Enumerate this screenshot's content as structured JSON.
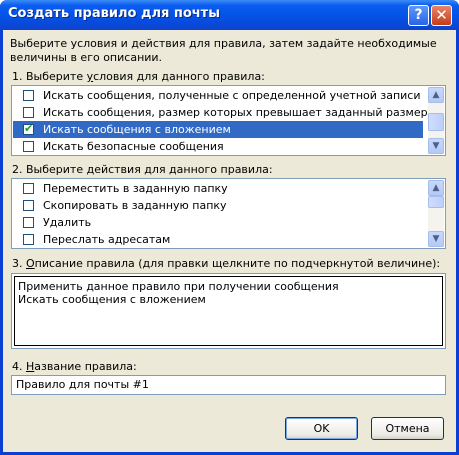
{
  "window": {
    "title": "Создать правило для почты",
    "help_glyph": "?",
    "close_glyph": "✕"
  },
  "intro": "Выберите условия и действия для правила, затем задайте необходимые величины в его описании.",
  "conditions": {
    "label_prefix": "1. Выберите ",
    "label_u": "у",
    "label_rest": "словия для данного правила:",
    "items": [
      {
        "label": "Искать сообщения, полученные с определенной учетной записи",
        "checked": false,
        "selected": false
      },
      {
        "label": "Искать сообщения, размер которых превышает заданный размер",
        "checked": false,
        "selected": false
      },
      {
        "label": "Искать сообщения с вложением",
        "checked": true,
        "selected": true
      },
      {
        "label": "Искать безопасные сообщения",
        "checked": false,
        "selected": false
      }
    ]
  },
  "actions": {
    "label_prefix": "2. Выберите ",
    "label_u": "д",
    "label_rest": "ействия для данного правила:",
    "items": [
      {
        "label": "Переместить в заданную папку",
        "checked": false
      },
      {
        "label": "Скопировать в заданную папку",
        "checked": false
      },
      {
        "label": "Удалить",
        "checked": false
      },
      {
        "label": "Переслать адресатам",
        "checked": false
      }
    ]
  },
  "description": {
    "label_prefix": "3. ",
    "label_u": "О",
    "label_rest": "писание правила (для правки щелкните по подчеркнутой величине):",
    "lines": [
      "Применить данное правило при получении сообщения",
      "Искать сообщения с вложением"
    ]
  },
  "name": {
    "label_prefix": "4. ",
    "label_u": "Н",
    "label_rest": "азвание правила:",
    "value": "Правило для почты #1"
  },
  "buttons": {
    "ok": "OK",
    "cancel": "Отмена"
  },
  "check_glyph": "✔",
  "scroll_up_glyph": "▲",
  "scroll_down_glyph": "▼"
}
